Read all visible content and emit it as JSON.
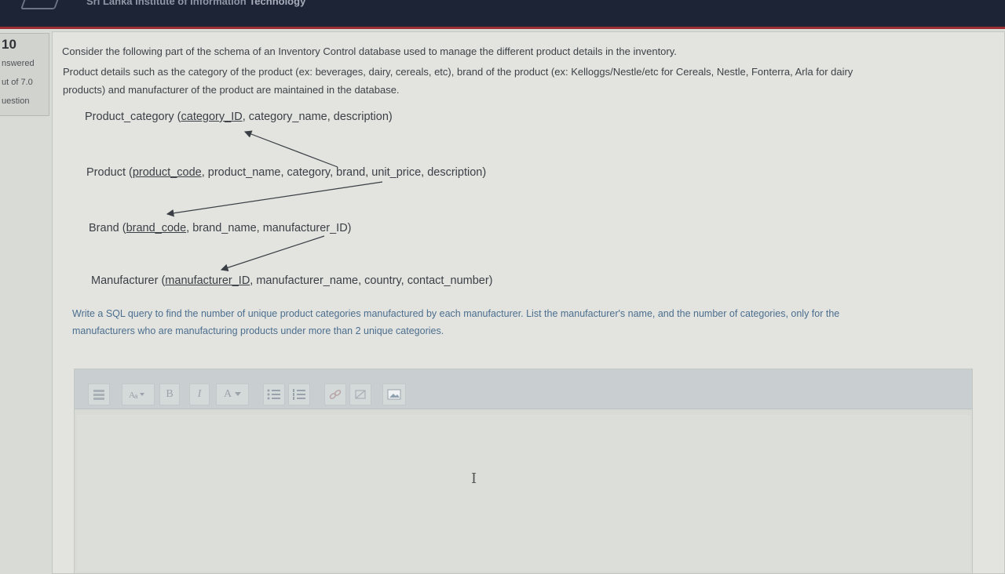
{
  "header": {
    "site_title_main": "Sri Lanka Institute of Information",
    "site_title_tail": "Technology"
  },
  "question_info": {
    "number": "10",
    "status": "nswered",
    "marks": "ut of 7.0",
    "flag": "uestion"
  },
  "question": {
    "intro": "Consider the following part of the schema of an Inventory Control database used to manage the different product details in the inventory.",
    "details_line1": "Product details such as the category of the product (ex: beverages, dairy, cereals, etc), brand of the product (ex: Kelloggs/Nestle/etc for Cereals, Nestle, Fonterra, Arla for dairy",
    "details_line2": "products) and manufacturer of the product are maintained in the database.",
    "schema": {
      "product_category": {
        "name": "Product_category (",
        "pk": "category_ID",
        "rest": ", category_name, description)"
      },
      "product": {
        "name": "Product (",
        "pk": "product_code",
        "rest": ", product_name, category, brand, unit_price, description)"
      },
      "brand": {
        "name": "Brand (",
        "pk": "brand_code",
        "rest": ", brand_name, manufacturer_ID)"
      },
      "manufacturer": {
        "name": "Manufacturer (",
        "pk": "manufacturer_ID",
        "rest": ", manufacturer_name, country, contact_number)"
      }
    },
    "task_line1": "Write a SQL query to find the number of unique product categories manufactured by each manufacturer. List the manufacturer's name, and the number of categories, only for the",
    "task_line2": "manufacturers who are manufacturing products under more than 2 unique categories."
  },
  "editor": {
    "toolbar": [
      {
        "name": "toggle-toolbar-icon"
      },
      {
        "name": "paragraph-styles-icon"
      },
      {
        "name": "bold-icon",
        "glyph": "B"
      },
      {
        "name": "italic-icon",
        "glyph": "I"
      },
      {
        "name": "font-color-icon",
        "glyph": "A"
      },
      {
        "name": "unordered-list-icon"
      },
      {
        "name": "ordered-list-icon"
      },
      {
        "name": "link-icon"
      },
      {
        "name": "unlink-icon"
      },
      {
        "name": "image-icon"
      }
    ],
    "content": ""
  }
}
